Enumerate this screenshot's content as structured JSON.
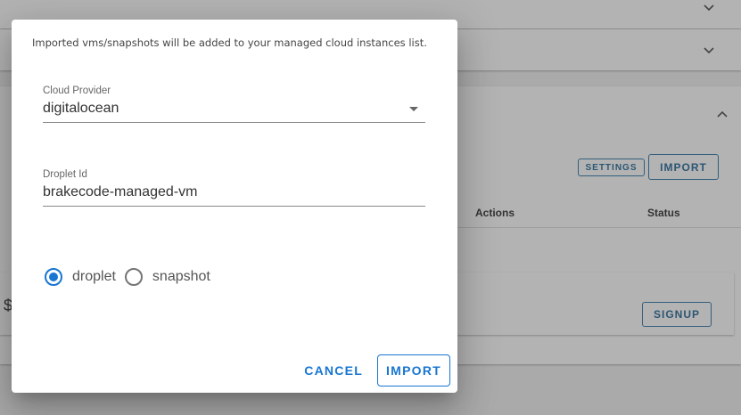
{
  "background": {
    "buttons": {
      "settings": "SETTINGS",
      "import": "IMPORT",
      "signup": "SIGNUP"
    },
    "table_headers": {
      "actions": "Actions",
      "status": "Status"
    },
    "edge_text": "$"
  },
  "dialog": {
    "intro": "Imported vms/snapshots will be added to your managed cloud instances list.",
    "cloud_provider": {
      "label": "Cloud Provider",
      "value": "digitalocean"
    },
    "droplet_id": {
      "label": "Droplet Id",
      "value": "brakecode-managed-vm"
    },
    "radio_options": [
      {
        "label": "droplet",
        "checked": true
      },
      {
        "label": "snapshot",
        "checked": false
      }
    ],
    "actions": {
      "cancel": "CANCEL",
      "import": "IMPORT"
    }
  },
  "colors": {
    "primary": "#1976d2",
    "overlay_bg": "#aaaaaa"
  }
}
